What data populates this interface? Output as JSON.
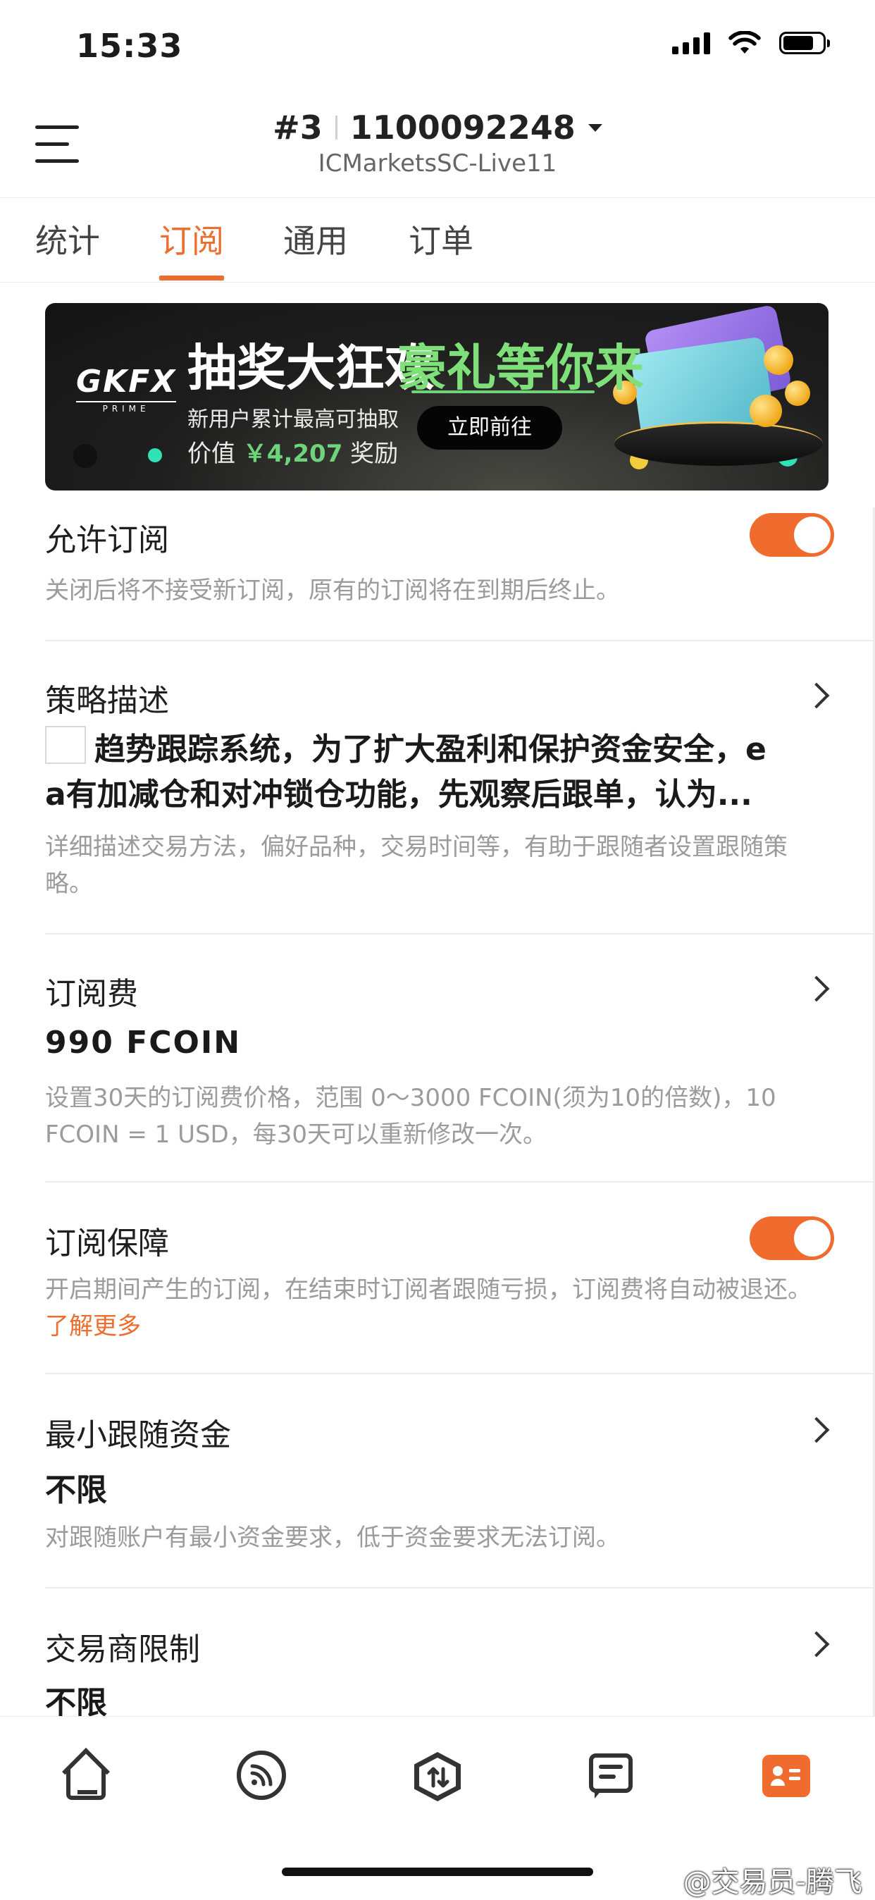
{
  "status_bar": {
    "time": "15:33"
  },
  "header": {
    "account_no": "#3",
    "account_id": "1100092248",
    "server": "ICMarketsSC-Live11"
  },
  "tabs": [
    {
      "label": "统计",
      "active": false
    },
    {
      "label": "订阅",
      "active": true
    },
    {
      "label": "通用",
      "active": false
    },
    {
      "label": "订单",
      "active": false
    }
  ],
  "banner": {
    "logo": "GKFX",
    "logo_sub": "PRIME",
    "title_white": "抽奖大狂欢",
    "title_green": "豪礼等你来",
    "subtitle1": "新用户累计最高可抽取",
    "subtitle2_pre": "价值",
    "value": "￥4,207",
    "subtitle2_post": "奖励",
    "button": "立即前往"
  },
  "settings": {
    "allow_subscription": {
      "title": "允许订阅",
      "enabled": true,
      "desc": "关闭后将不接受新订阅，原有的订阅将在到期后终止。"
    },
    "strategy": {
      "title": "策略描述",
      "text_line1": "趋势跟踪系统，为了扩大盈利和保护资金安全，e",
      "text_line2": "a有加减仓和对冲锁仓功能，先观察后跟单，认为...",
      "desc": "详细描述交易方法，偏好品种，交易时间等，有助于跟随者设置跟随策略。"
    },
    "fee": {
      "title": "订阅费",
      "value": "990 FCOIN",
      "desc": "设置30天的订阅费价格，范围 0～3000 FCOIN(须为10的倍数)，10 FCOIN = 1 USD，每30天可以重新修改一次。"
    },
    "guarantee": {
      "title": "订阅保障",
      "enabled": true,
      "desc": "开启期间产生的订阅，在结束时订阅者跟随亏损，订阅费将自动被退还。",
      "link": "了解更多"
    },
    "min_funds": {
      "title": "最小跟随资金",
      "value": "不限",
      "desc": "对跟随账户有最小资金要求，低于资金要求无法订阅。"
    },
    "broker_limit": {
      "title": "交易商限制",
      "value": "不限"
    }
  },
  "bottom_nav": [
    "home-icon",
    "feed-icon",
    "trade-icon",
    "messages-icon",
    "profile-icon"
  ],
  "watermark": "@交易员-腾飞",
  "colors": {
    "accent": "#ec6d2d",
    "toggle_on": "#ef6b2e",
    "banner_green": "#7fe07a"
  }
}
